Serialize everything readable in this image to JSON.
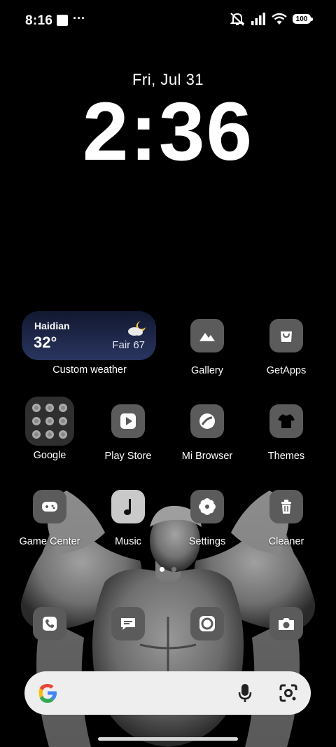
{
  "status_bar": {
    "time": "8:16",
    "more": "···",
    "battery": "100",
    "icons": [
      "notification-square-icon",
      "mute-icon",
      "signal-icon",
      "wifi-icon",
      "battery-icon"
    ]
  },
  "lockscreen": {
    "date": "Fri, Jul 31",
    "time": "2:36"
  },
  "weather_widget": {
    "location": "Haidian",
    "temperature": "32°",
    "condition": "Fair 67",
    "label": "Custom weather",
    "accent": "#2a3560"
  },
  "apps": {
    "gallery": "Gallery",
    "getapps": "GetApps",
    "google": "Google",
    "play_store": "Play Store",
    "mi_browser": "Mi Browser",
    "themes": "Themes",
    "game_center": "Game Center",
    "music": "Music",
    "settings": "Settings",
    "cleaner": "Cleaner"
  },
  "dock": [
    "phone-icon",
    "messaging-icon",
    "browser-icon",
    "camera-icon"
  ],
  "search": {
    "placeholder": ""
  }
}
